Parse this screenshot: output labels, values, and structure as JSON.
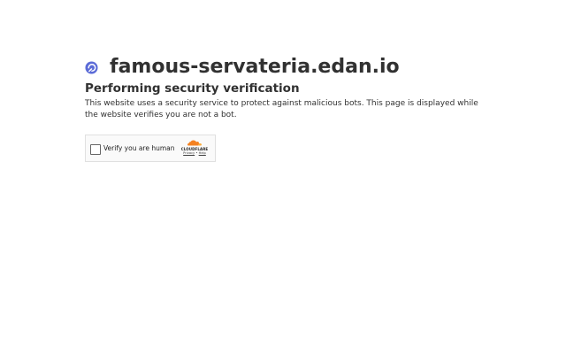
{
  "site": {
    "hostname": "famous-servateria.edan.io",
    "favicon_icon": "globe-check-icon"
  },
  "main": {
    "heading": "Performing security verification",
    "description": "This website uses a security service to protect against malicious bots. This page is displayed while the website verifies you are not a bot."
  },
  "challenge_widget": {
    "checkbox_label": "Verify you are human",
    "checkbox_checked": false,
    "brand_name": "CLOUDFLARE",
    "brand_icon": "cloudflare-cloud-icon",
    "privacy_link": "Privacy",
    "separator": "•",
    "help_link": "Help"
  },
  "colors": {
    "text": "#313131",
    "favicon_accent": "#5b6bd7",
    "cloudflare_orange": "#f48120",
    "cloudflare_light": "#faad3f",
    "widget_background": "#fafafa",
    "widget_border": "#e0e0e0"
  }
}
